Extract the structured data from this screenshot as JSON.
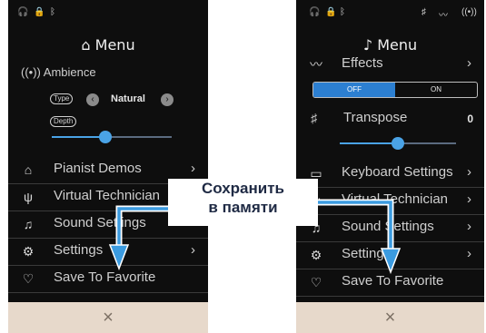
{
  "left": {
    "menu_title": "Menu",
    "ambience": {
      "label": "Ambience",
      "type_label": "Type",
      "type_value": "Natural",
      "depth_label": "Depth",
      "depth_level": 0.45
    },
    "items": [
      {
        "label": "Pianist Demos",
        "icon": "piano-icon"
      },
      {
        "label": "Virtual Technician",
        "icon": "tuning-fork-icon"
      },
      {
        "label": "Sound Settings",
        "icon": "headphones-icon"
      },
      {
        "label": "Settings",
        "icon": "gear-icon"
      },
      {
        "label": "Save To Favorite",
        "icon": "heart-icon"
      }
    ],
    "close": "×"
  },
  "right": {
    "menu_title": "Menu",
    "effects": {
      "label": "Effects",
      "off": "OFF",
      "on": "ON"
    },
    "transpose": {
      "label": "Transpose",
      "value": "0",
      "level": 0.5
    },
    "items": [
      {
        "label": "Keyboard Settings",
        "icon": "keyboard-icon"
      },
      {
        "label": "Virtual Technician",
        "icon": "tuning-fork-icon"
      },
      {
        "label": "Sound Settings",
        "icon": "headphones-icon"
      },
      {
        "label": "Settings",
        "icon": "gear-icon"
      },
      {
        "label": "Save To Favorite",
        "icon": "heart-icon"
      }
    ],
    "close": "×"
  },
  "caption": {
    "line1": "Сохранить",
    "line2": "в памяти"
  },
  "colors": {
    "accent": "#4aa3e6",
    "background": "#0e0e0e",
    "footer": "#e7d9cb",
    "caption": "#1f2a44"
  }
}
